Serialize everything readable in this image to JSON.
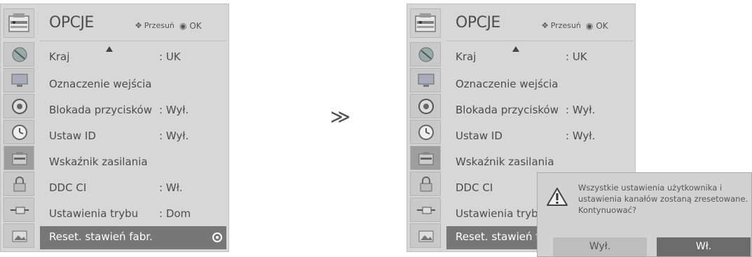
{
  "menu": {
    "title": "OPCJE",
    "hint_move": "Przesuń",
    "hint_ok": "OK",
    "items": [
      {
        "label": "Kraj",
        "value": ": UK"
      },
      {
        "label": "Oznaczenie wejścia",
        "value": ""
      },
      {
        "label": "Blokada przycisków",
        "value": ": Wył."
      },
      {
        "label": "Ustaw ID",
        "value": ": Wył."
      },
      {
        "label": "Wskaźnik zasilania",
        "value": ""
      },
      {
        "label": "DDC CI",
        "value": ": Wł."
      },
      {
        "label": "Ustawienia trybu",
        "value": ": Dom"
      },
      {
        "label": "Reset. stawień fabr.",
        "value": ""
      }
    ],
    "partial_value": "Wł"
  },
  "next_symbol": "≫",
  "dialog": {
    "message": "Wszystkie ustawienia użytkownika i ustawienia kanałów zostaną zresetowane. Kontynuować?",
    "no_label": "Wył.",
    "yes_label": "Wł."
  },
  "sidebar_icons": [
    "satellite-icon",
    "monitor-icon",
    "speaker-icon",
    "clock-icon",
    "options-icon",
    "lock-icon",
    "input-plug-icon",
    "picture-icon"
  ],
  "colors": {
    "menu_bg": "#d7d7d7",
    "selected_bg": "#777777",
    "dialog_yes": "#6c6c6c"
  }
}
